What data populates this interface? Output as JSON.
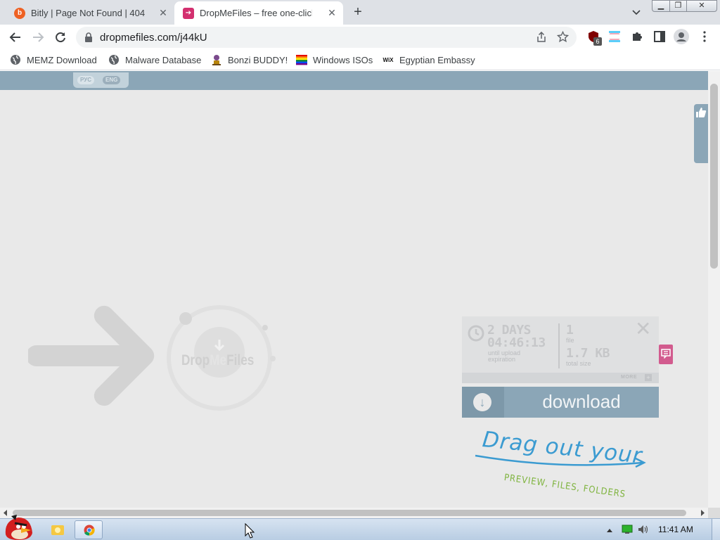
{
  "browser": {
    "tabs": [
      {
        "title": "Bitly | Page Not Found | 404",
        "favicon": "bitly-icon",
        "active": false
      },
      {
        "title": "DropMeFiles – free one-click f",
        "favicon": "dropmefiles-icon",
        "active": true
      }
    ],
    "address": {
      "url": "dropmefiles.com/j44kU"
    },
    "extension_badge": "6",
    "bookmarks": [
      {
        "label": "MEMZ Download",
        "icon": "globe-icon"
      },
      {
        "label": "Malware Database",
        "icon": "globe-icon"
      },
      {
        "label": "Bonzi BUDDY!",
        "icon": "bonzi-icon"
      },
      {
        "label": "Windows ISOs",
        "icon": "rainbow-flag-icon"
      },
      {
        "label": "Egyptian Embassy",
        "icon": "wix-icon"
      }
    ],
    "wix_text": "WiX"
  },
  "page": {
    "lang": {
      "ru": "РУС",
      "en": "ENG"
    },
    "logo": {
      "drop": "Drop",
      "me": "Me",
      "files": "Files"
    },
    "info": {
      "days": "2 DAYS",
      "time": "04:46:13",
      "expiry_label_1": "until upload",
      "expiry_label_2": "expiration",
      "file_count": "1",
      "file_label": "file",
      "size": "1.7 KB",
      "size_label": "total size",
      "more": "MORE",
      "more_plus": "+"
    },
    "download_label": "download",
    "drag": {
      "line1": "Drag out your",
      "line2": "PREVIEW, FILES, FOLDERS"
    }
  },
  "taskbar": {
    "time": "11:41 AM"
  },
  "colors": {
    "accent": "#8ba6b7",
    "page_bg": "#e9e9e9",
    "drag_blue": "#3b9bd1",
    "drag_green": "#7fb43f"
  }
}
